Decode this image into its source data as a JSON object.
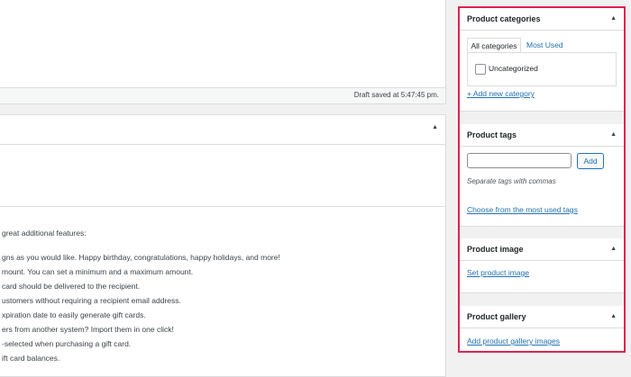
{
  "editor": {
    "draft_status": "Draft saved at 5:47:45 pm.",
    "features_intro": "great additional features:",
    "features": [
      "gns as you would like. Happy birthday, congratulations, happy holidays, and more!",
      "mount. You can set a minimum and a maximum amount.",
      "card should be delivered to the recipient.",
      "ustomers without requiring a recipient email address.",
      "xpiration date to easily generate gift cards.",
      "ers from another system? Import them in one click!",
      "-selected when purchasing a gift card.",
      "ift card balances."
    ]
  },
  "sidebar": {
    "categories": {
      "title": "Product categories",
      "tabs": [
        "All categories",
        "Most Used"
      ],
      "items": [
        "Uncategorized"
      ],
      "add_link": "+ Add new category"
    },
    "tags": {
      "title": "Product tags",
      "input_value": "",
      "add_label": "Add",
      "hint": "Separate tags with commas",
      "choose_link": "Choose from the most used tags"
    },
    "image": {
      "title": "Product image",
      "set_link": "Set product image"
    },
    "gallery": {
      "title": "Product gallery",
      "add_link": "Add product gallery images"
    },
    "highlight_color": "#e0234e",
    "link_color": "#2271b1"
  }
}
